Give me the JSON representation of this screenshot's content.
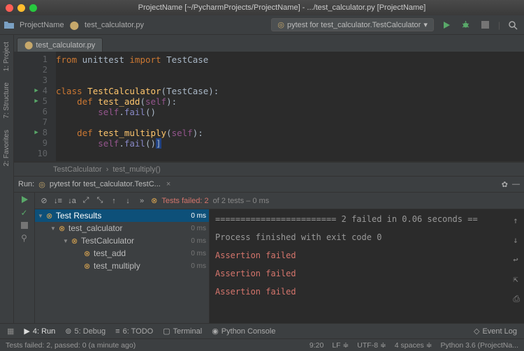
{
  "window": {
    "title": "ProjectName [~/PycharmProjects/ProjectName] - .../test_calculator.py [ProjectName]"
  },
  "breadcrumb": {
    "project": "ProjectName",
    "file": "test_calculator.py"
  },
  "run_config": {
    "label": "pytest for test_calculator.TestCalculator"
  },
  "tabs": {
    "editor_tab": "test_calculator.py"
  },
  "left_tool_tabs": [
    "1: Project",
    "7: Structure",
    "2: Favorites"
  ],
  "code": {
    "l1_kw1": "from",
    "l1_mod": "unittest",
    "l1_kw2": "import",
    "l1_cls": "TestCase",
    "l4_kw": "class",
    "l4_name": "TestCalculator",
    "l4_base": "TestCase",
    "l5_kw": "def",
    "l5_name": "test_add",
    "l5_param": "self",
    "l6_self": "self",
    "l6_fn": "fail",
    "l8_kw": "def",
    "l8_name": "test_multiply",
    "l8_param": "self",
    "l9_self": "self",
    "l9_fn": "fail"
  },
  "code_breadcrumb": {
    "c1": "TestCalculator",
    "c2": "test_multiply()"
  },
  "run": {
    "label": "Run:",
    "tab": "pytest for test_calculator.TestC...",
    "filter_prefix": "Tests failed: 2",
    "filter_suffix": "of 2 tests – 0 ms"
  },
  "tree": {
    "root": "Test Results",
    "n1": "test_calculator",
    "n2": "TestCalculator",
    "n3": "test_add",
    "n4": "test_multiply",
    "t0": "0 ms",
    "t1": "0 ms",
    "t2": "0 ms",
    "t3": "0 ms",
    "t4": "0 ms"
  },
  "console": {
    "line1": "======================== 2 failed in 0.06 seconds ==",
    "line2": "Process finished with exit code 0",
    "err": "Assertion failed"
  },
  "toolstrip": {
    "run": "4: Run",
    "debug": "5: Debug",
    "todo": "6: TODO",
    "terminal": "Terminal",
    "pyconsole": "Python Console",
    "eventlog": "Event Log"
  },
  "status": {
    "msg": "Tests failed: 2, passed: 0 (a minute ago)",
    "pos": "9:20",
    "le": "LF",
    "enc": "UTF-8",
    "indent": "4 spaces",
    "interp": "Python 3.6 (ProjectNa..."
  }
}
